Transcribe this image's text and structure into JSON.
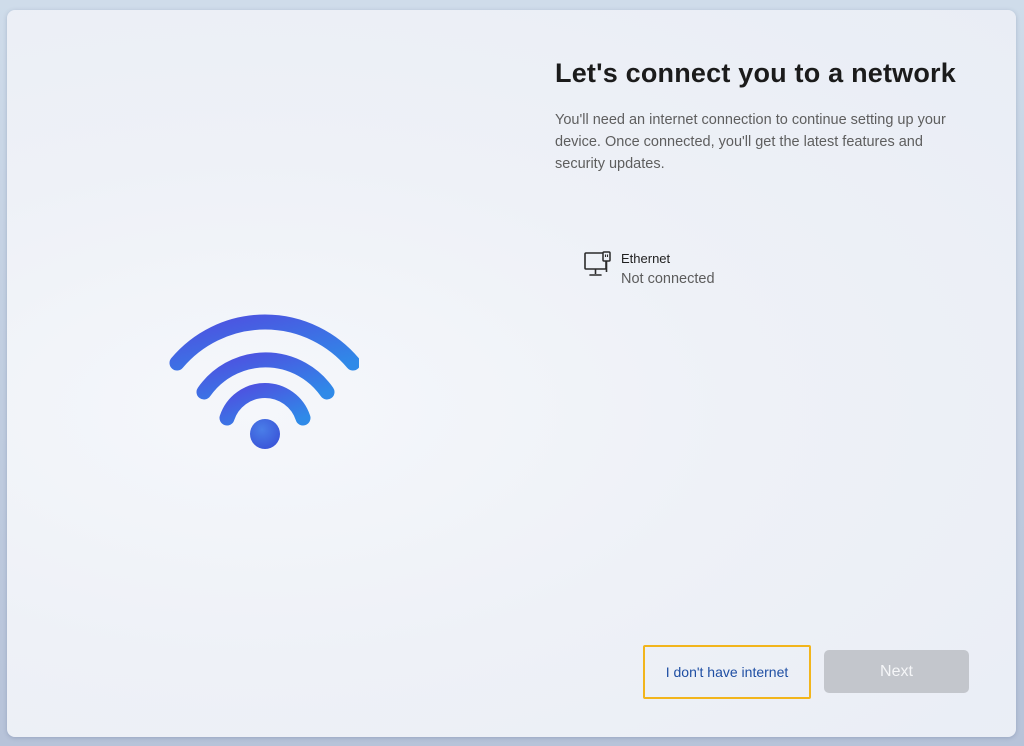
{
  "heading": {
    "title": "Let's connect you to a network",
    "subtitle": "You'll need an internet connection to continue setting up your device. Once connected, you'll get the latest features and security updates."
  },
  "networks": [
    {
      "name": "Ethernet",
      "status": "Not connected",
      "icon": "ethernet-icon"
    }
  ],
  "hero": {
    "icon": "wifi-icon",
    "colors": {
      "start": "#4f4fe0",
      "end": "#2f8ae8"
    }
  },
  "actions": {
    "no_internet_label": "I don't have internet",
    "next_label": "Next",
    "next_enabled": false
  },
  "colors": {
    "focus_outline": "#f2b51c",
    "link": "#1f4fa3",
    "disabled_button": "#c3c6cc"
  }
}
